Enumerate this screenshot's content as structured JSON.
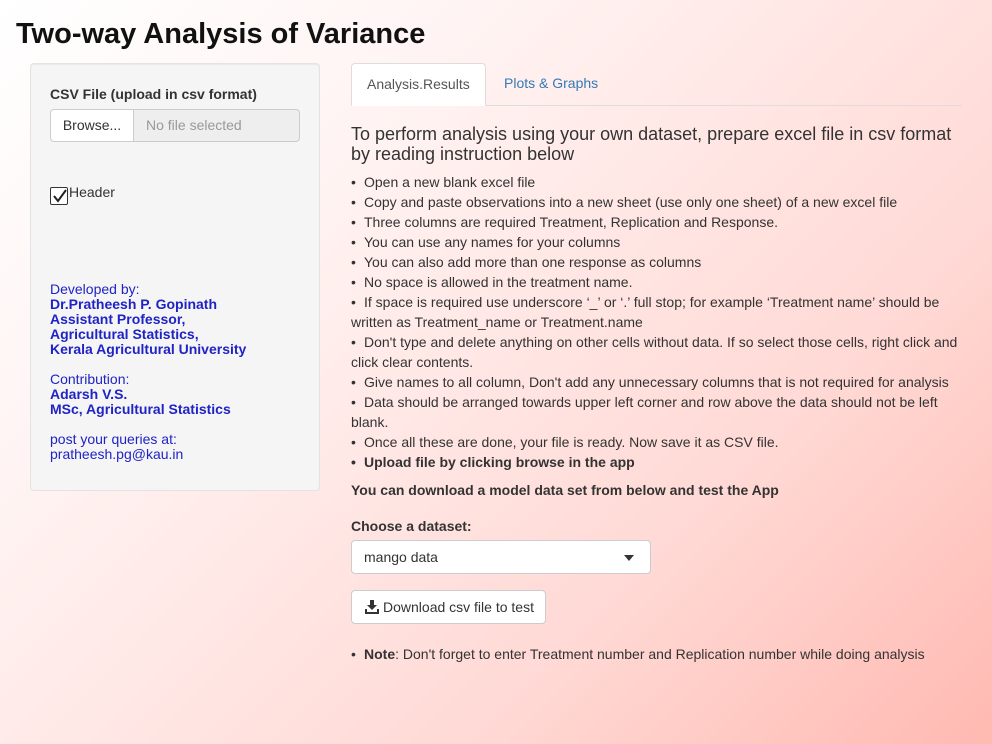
{
  "app": {
    "title": "Two-way Analysis of Variance"
  },
  "sidebar": {
    "file_label": "CSV File (upload in csv format)",
    "browse_label": "Browse...",
    "file_placeholder": "No file selected",
    "header_checkbox": {
      "label": "Header",
      "checked": true
    },
    "developed_by_label": "Developed by:",
    "developer_lines": [
      "Dr.Pratheesh P. Gopinath",
      "Assistant Professor,",
      "Agricultural Statistics,",
      "Kerala Agricultural University"
    ],
    "contribution_label": "Contribution:",
    "contributor_lines": [
      "Adarsh V.S.",
      "MSc, Agricultural Statistics"
    ],
    "queries_label": "post your queries at:",
    "email": "pratheesh.pg@kau.in"
  },
  "tabs": [
    {
      "label": "Analysis.Results",
      "active": true
    },
    {
      "label": "Plots & Graphs",
      "active": false
    }
  ],
  "main": {
    "intro": "To perform analysis using your own dataset, prepare excel file in csv format by reading instruction below",
    "steps": [
      "Open a new blank excel file",
      "Copy and paste observations into a new sheet (use only one sheet) of a new excel file",
      "Three columns are required Treatment, Replication and Response.",
      "You can use any names for your columns",
      "You can also add more than one response as columns",
      "No space is allowed in the treatment name.",
      "If space is required use underscore ‘_’ or ‘.’ full stop; for example ‘Treatment name’ should be written as Treatment_name or Treatment.name",
      "Don't type and delete anything on other cells without data. If so select those cells, right click and click clear contents.",
      "Give names to all column, Don't add any unnecessary columns that is not required for analysis",
      "Data should be arranged towards upper left corner and row above the data should not be left blank.",
      "Once all these are done, your file is ready. Now save it as CSV file.",
      "Upload file by clicking browse in the app"
    ],
    "download_hint": "You can download a model data set from below and test the App",
    "choose_label": "Choose a dataset:",
    "dataset_selected": "mango data",
    "download_button": "Download csv file to test",
    "note_label": "Note",
    "note_text": ": Don't forget to enter Treatment number and Replication number while doing analysis"
  }
}
